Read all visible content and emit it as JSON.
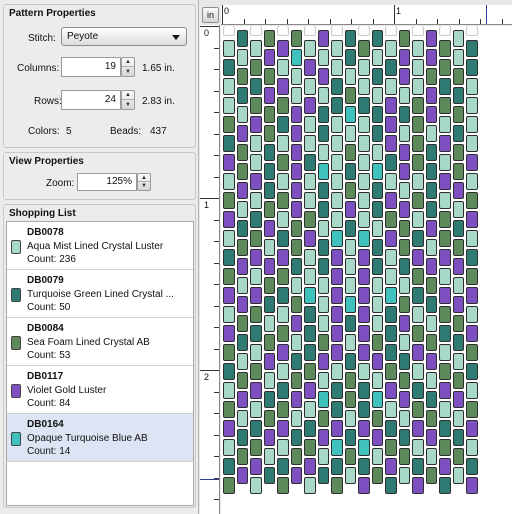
{
  "pattern_properties": {
    "title": "Pattern Properties",
    "stitch_label": "Stitch:",
    "stitch_value": "Peyote",
    "columns_label": "Columns:",
    "columns_value": "19",
    "columns_inches": "1.65 in.",
    "rows_label": "Rows:",
    "rows_value": "24",
    "rows_inches": "2.83 in.",
    "colors_label": "Colors:",
    "colors_value": "5",
    "beads_label": "Beads:",
    "beads_value": "437"
  },
  "view_properties": {
    "title": "View Properties",
    "zoom_label": "Zoom:",
    "zoom_value": "125%"
  },
  "shopping_list": {
    "title": "Shopping List",
    "items": [
      {
        "code": "DB0078",
        "name": "Aqua Mist Lined Crystal Luster",
        "count": "Count: 236",
        "color": "#a8d8c8",
        "selected": false
      },
      {
        "code": "DB0079",
        "name": "Turquoise Green Lined Crystal ...",
        "count": "Count: 50",
        "color": "#2f7a72",
        "selected": false
      },
      {
        "code": "DB0084",
        "name": "Sea Foam Lined Crystal AB",
        "count": "Count: 53",
        "color": "#5c8a5a",
        "selected": false
      },
      {
        "code": "DB0117",
        "name": "Violet Gold Luster",
        "count": "Count: 84",
        "color": "#7d4fc0",
        "selected": false
      },
      {
        "code": "DB0164",
        "name": "Opaque Turquoise Blue AB",
        "count": "Count: 14",
        "color": "#3fc2bd",
        "selected": true
      }
    ]
  },
  "canvas": {
    "unit_button": "in",
    "ruler_top_labels": [
      "0",
      "1"
    ],
    "ruler_left_labels": [
      "0",
      "1",
      "2"
    ]
  },
  "bead_colors": {
    "A": "#a8d8c8",
    "T": "#2f7a72",
    "S": "#5c8a5a",
    "V": "#7d4fc0",
    "O": "#3fc2bd"
  },
  "bead_rows": [
    "ATASVSAVATSTASAVSAT",
    "TASVAOVAATAATVAVSAT",
    "ASTSVAAVTAATAVASTSA",
    "ATSVSAVATSTAVASVSTA",
    "SAVSTVATAOATVTSVASA",
    "TVASAVATAAATVASAVTA",
    "VSATSVTAASAATVSTASV",
    "ASVTAVAOATAOAVATVSA",
    "SVATSVATASATVASTAVS",
    "VATSAVSTAVATSVATSAV",
    "ATSVTSVAOTOAVSTVSTA",
    "TSVAVSATVAVTASVAVST",
    "SVAVSTATVAVTATSVAVS",
    "VAVSTAOAVAVAOATSVAV",
    "AVSTASTAVOVATSATSVA",
    "VSTASVTAVTVATVSATSV",
    "STASVATSVAVSTAVSATS",
    "TASVATSVATAVSTAVSAT",
    "ASVATSVATSTAVSTAVSA",
    "SVATSVAOTSTOAVSTAVS",
    "VATSVATSVAVSTAVSTAV",
    "ATSVATSVOTOVSTAVSTA",
    "TSVATSVATSTAVSTAVST",
    "SVATSVATSAVSTAVSTAV"
  ]
}
